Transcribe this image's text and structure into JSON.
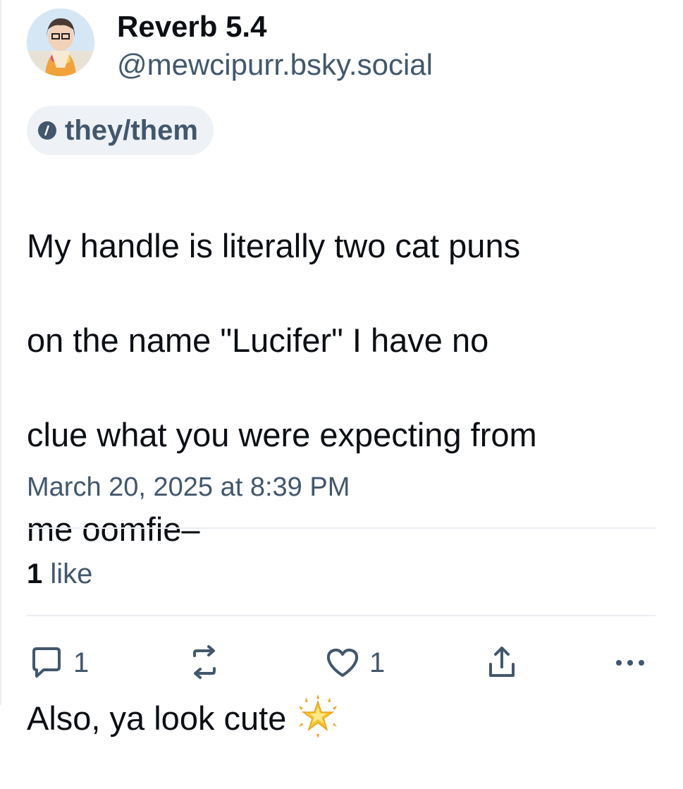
{
  "author": {
    "display_name": "Reverb 5.4",
    "handle": "@mewcipurr.bsky.social",
    "pronouns": "they/them"
  },
  "post": {
    "lines": [
      "My handle is literally two cat puns",
      "on the name \"Lucifer\" I have no",
      "clue what you were expecting from",
      "me oomfie–",
      "Also, ya look cute"
    ],
    "emoji": "glowing-star-emoji",
    "timestamp": "March 20, 2025 at 8:39 PM"
  },
  "stats": {
    "like_count": "1",
    "like_label": "like"
  },
  "actions": {
    "reply_count": "1",
    "like_count": "1",
    "icons": [
      "reply-icon",
      "repost-icon",
      "like-icon",
      "share-icon",
      "more-icon"
    ]
  },
  "colors": {
    "text": "#0b0f14",
    "muted": "#42576c",
    "divider": "#e9edf1",
    "chip_bg": "#eef1f5"
  }
}
